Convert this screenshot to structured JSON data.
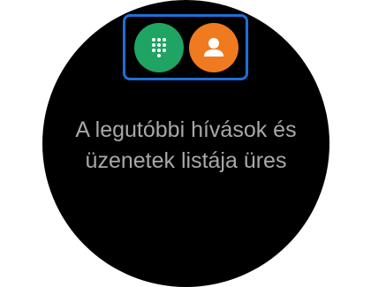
{
  "colors": {
    "watch_background": "#000000",
    "page_background": "#ffffff",
    "highlight_border": "#1f6fd8",
    "dialpad_button": "#1fa463",
    "contacts_button": "#f07a20",
    "message_text": "#a8a8a8"
  },
  "actions": {
    "dialpad": {
      "icon": "dialpad-icon"
    },
    "contacts": {
      "icon": "person-icon"
    }
  },
  "empty_state": {
    "line1": "A legutóbbi hívások és",
    "line2": "üzenetek listája üres"
  }
}
